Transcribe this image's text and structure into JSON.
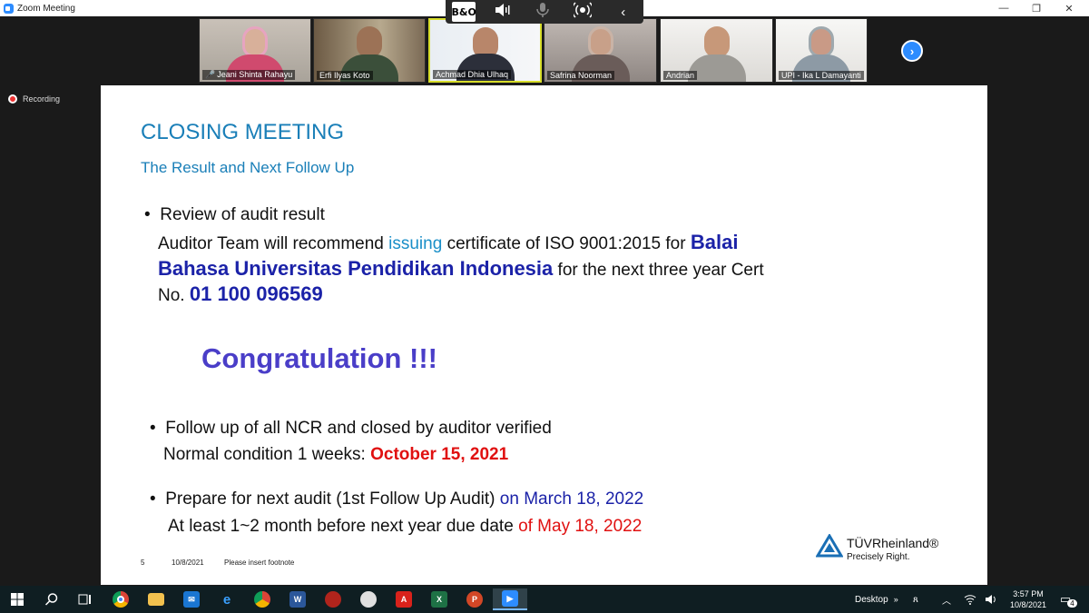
{
  "window": {
    "title": "Zoom Meeting"
  },
  "floating_toolbar": {
    "bo_label": "B&O"
  },
  "participants": [
    {
      "name": "Jeani Shinta Rahayu",
      "muted": true
    },
    {
      "name": "Erfi Ilyas Koto",
      "muted": false
    },
    {
      "name": "Achmad Dhia Ulhaq",
      "muted": false
    },
    {
      "name": "Safrina Noorman",
      "muted": false
    },
    {
      "name": "Andrian",
      "muted": false
    },
    {
      "name": "UPI - Ika L Damayanti",
      "muted": false
    }
  ],
  "recording_label": "Recording",
  "slide": {
    "title": "CLOSING MEETING",
    "subtitle": "The Result and Next Follow Up",
    "bullet1": {
      "heading": "Review of audit result",
      "line1_a": "Auditor Team will recommend ",
      "line1_b": "issuing",
      "line1_c": " certificate of ISO 9001:2015 for ",
      "line1_d": "Balai",
      "line2_a": "Bahasa Universitas Pendidikan Indonesia",
      "line2_b": " for the next three year Cert",
      "line3_a": "No. ",
      "line3_b": "01 100 096569"
    },
    "congrats": "Congratulation  !!!",
    "bullet2": {
      "heading": "Follow up of all NCR and closed by auditor verified",
      "line_a": "Normal condition 1 weeks: ",
      "line_b": "October 15, 2021"
    },
    "bullet3": {
      "heading_a": "Prepare for next audit (1st Follow Up Audit) ",
      "heading_b": "on  March 18, 2022",
      "line_a": "At least 1~2 month before next year due date ",
      "line_b": "of May 18, 2022"
    },
    "footer": {
      "page": "5",
      "date": "10/8/2021",
      "note": "Please insert footnote"
    },
    "logo": {
      "brand": "TÜVRheinland®",
      "tagline": "Precisely Right."
    }
  },
  "taskbar": {
    "desktop_label": "Desktop",
    "time": "3:57 PM",
    "date": "10/8/2021",
    "notifications": "4"
  },
  "colors": {
    "slide_title": "#1a7fb8",
    "highlight_navy": "#1b22a8",
    "highlight_red": "#e01010",
    "congrats": "#4a3ec8",
    "zoom_blue": "#2d8cff"
  }
}
